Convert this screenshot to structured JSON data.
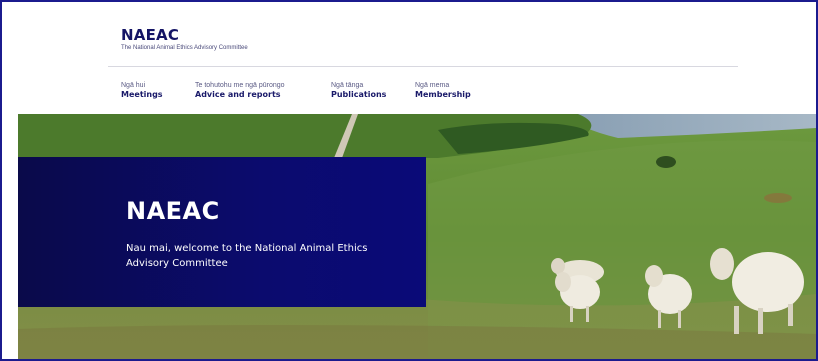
{
  "brand": {
    "name": "NAEAC",
    "subtitle": "The National Animal Ethics Advisory Committee"
  },
  "nav": [
    {
      "maori": "Ngā hui",
      "label": "Meetings"
    },
    {
      "maori": "Te tohutohu me ngā pūrongo",
      "label": "Advice and reports"
    },
    {
      "maori": "Ngā tānga",
      "label": "Publications"
    },
    {
      "maori": "Ngā mema",
      "label": "Membership"
    }
  ],
  "hero": {
    "title": "NAEAC",
    "text": "Nau mai, welcome to the National Animal Ethics Advisory Committee"
  },
  "colors": {
    "brand_navy": "#141465",
    "panel_navy": "#0b0b6e",
    "frame_border": "#1b1b8e"
  }
}
